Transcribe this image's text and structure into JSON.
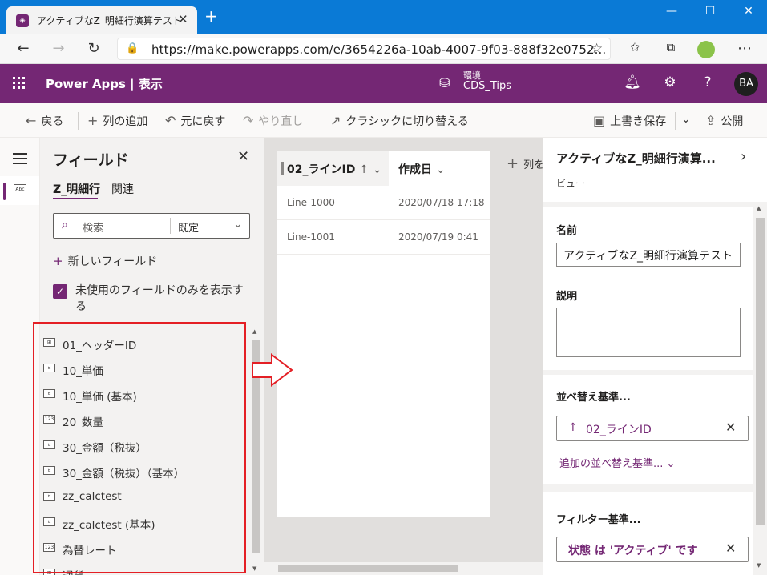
{
  "browser": {
    "tab_title": "アクティブなZ_明細行演算テスト",
    "tab_close": "✕",
    "new_tab": "+",
    "url": "https://make.powerapps.com/e/3654226a-10ab-4007-9f03-888f32e0752...",
    "window_buttons": [
      "—",
      "☐",
      "✕"
    ]
  },
  "header": {
    "app_title": "Power Apps  |  表示",
    "env_label": "環境",
    "env_name": "CDS_Tips",
    "avatar": "BA"
  },
  "commands": {
    "back": "戻る",
    "add_column": "列の追加",
    "undo": "元に戻す",
    "redo": "やり直し",
    "switch_classic": "クラシックに切り替える",
    "save": "上書き保存",
    "publish": "公開"
  },
  "fields_panel": {
    "title": "フィールド",
    "tabs": [
      "Z_明細行",
      "関連"
    ],
    "search_placeholder": "検索",
    "filter_value": "既定",
    "new_field": "新しいフィールド",
    "unused_only_label": "未使用のフィールドのみを表示する",
    "items": [
      {
        "icon": "key-field-icon",
        "label": "01_ヘッダーID"
      },
      {
        "icon": "currency-field-icon",
        "label": "10_単価"
      },
      {
        "icon": "currency-field-icon",
        "label": "10_単価 (基本)"
      },
      {
        "icon": "number-field-icon",
        "label": "20_数量"
      },
      {
        "icon": "currency-field-icon",
        "label": "30_金額（税抜）"
      },
      {
        "icon": "currency-field-icon",
        "label": "30_金額（税抜）（基本）"
      },
      {
        "icon": "currency-field-icon",
        "label": "zz_calctest"
      },
      {
        "icon": "currency-field-icon",
        "label": "zz_calctest (基本)"
      },
      {
        "icon": "number-field-icon",
        "label": "為替レート"
      },
      {
        "icon": "lookup-field-icon",
        "label": "通貨"
      }
    ]
  },
  "grid": {
    "columns": [
      {
        "label": "02_ラインID",
        "sort": "↑"
      },
      {
        "label": "作成日"
      }
    ],
    "rows": [
      [
        "Line-1000",
        "2020/07/18 17:18"
      ],
      [
        "Line-1001",
        "2020/07/19 0:41"
      ]
    ],
    "add_column": "列を"
  },
  "properties": {
    "title": "アクティブなZ_明細行演算...",
    "subtitle": "ビュー",
    "name_label": "名前",
    "name_value": "アクティブなZ_明細行演算テスト",
    "description_label": "説明",
    "sort_label": "並べ替え基準...",
    "sort_value": "02_ラインID",
    "add_sort": "追加の並べ替え基準...",
    "filter_label": "フィルター基準...",
    "filter_value": "状態 は 'アクティブ' です"
  },
  "colors": {
    "brand": "#742774",
    "highlight": "#e41f25",
    "browser": "#0a7ad6"
  }
}
